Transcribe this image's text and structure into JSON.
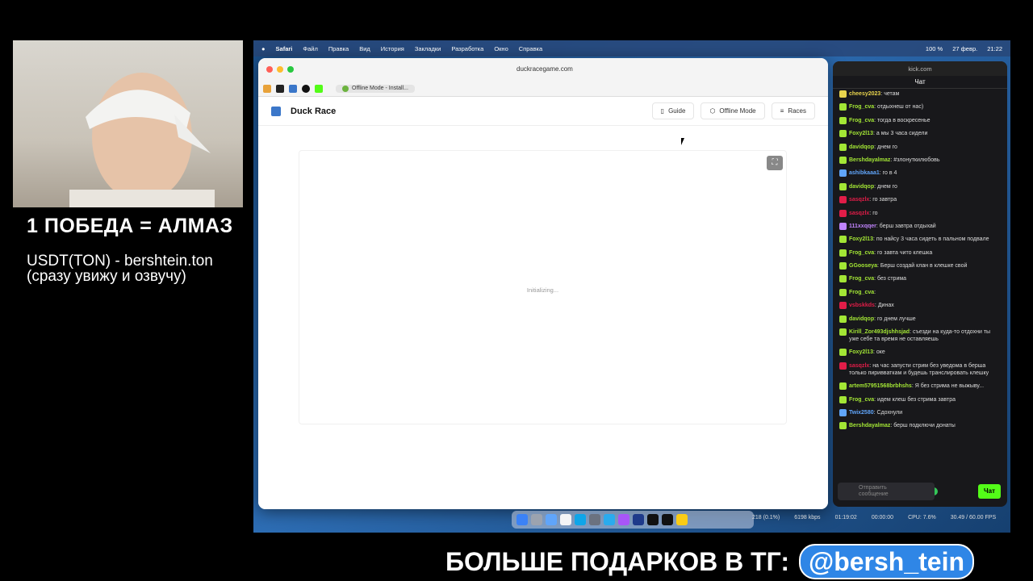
{
  "overlay": {
    "title": "1 ПОБЕДА = АЛМАЗ",
    "wallet_line1": "USDT(TON) - bershtein.ton",
    "wallet_line2": "(сразу увижу и озвучу)",
    "banner": "БОЛЬШЕ ПОДАРКОВ В ТГ:",
    "handle": "@bersh_tein"
  },
  "menubar": {
    "apple": "",
    "items": [
      "Safari",
      "Файл",
      "Правка",
      "Вид",
      "История",
      "Закладки",
      "Разработка",
      "Окно",
      "Справка"
    ],
    "right": [
      "100 %",
      "27 февр.",
      "21:22"
    ]
  },
  "safari": {
    "url": "duckracegame.com",
    "active_tab": "Offline Mode - Install..."
  },
  "site": {
    "title": "Duck Race",
    "nav": [
      "Guide",
      "Offline Mode",
      "Races"
    ],
    "status": "Initializing..."
  },
  "kick": {
    "url": "kick.com",
    "header": "Чат",
    "messages": [
      {
        "user": "cheesy2023",
        "text": "четам",
        "color": "#e8d44d"
      },
      {
        "user": "Frog_cva",
        "text": "отдыхнеш от нас)",
        "color": "#a3e635"
      },
      {
        "user": "Frog_cva",
        "text": "тогда в воскресенье",
        "color": "#a3e635"
      },
      {
        "user": "Foxy2l13",
        "text": "а мы 3 часа сидели",
        "color": "#a3e635"
      },
      {
        "user": "davidqop",
        "text": "днем го",
        "color": "#a3e635"
      },
      {
        "user": "Bershdayalmaz",
        "text": "#злонуткилюбовь",
        "color": "#a3e635"
      },
      {
        "user": "ashibkaaa1",
        "text": "го в 4",
        "color": "#60a5fa"
      },
      {
        "user": "davidqop",
        "text": "днем го",
        "color": "#a3e635"
      },
      {
        "user": "sasqzlx",
        "text": "го завтра",
        "color": "#e11d48"
      },
      {
        "user": "sasqzlx",
        "text": "го",
        "color": "#e11d48"
      },
      {
        "user": "111xxqqer",
        "text": "берш завтра отдыхай",
        "color": "#c084fc"
      },
      {
        "user": "Foxy2l13",
        "text": "по найсу 3 часа сидеть в пальном подвале",
        "color": "#a3e635"
      },
      {
        "user": "Frog_cva",
        "text": "го завта чито клешка",
        "color": "#a3e635"
      },
      {
        "user": "GGooseya",
        "text": "Берш создай клан в клешке свой",
        "color": "#a3e635"
      },
      {
        "user": "Frog_cva",
        "text": "без стрима",
        "color": "#a3e635"
      },
      {
        "user": "Frog_cva",
        "text": "",
        "color": "#a3e635"
      },
      {
        "user": "vsbskkds",
        "text": "Динах",
        "color": "#e11d48"
      },
      {
        "user": "davidqop",
        "text": "го днем лучше",
        "color": "#a3e635"
      },
      {
        "user": "Kirill_Zor493djshhsjad",
        "text": "съезди на куда-то отдохни ты уже себе та время не оставляешь",
        "color": "#a3e635"
      },
      {
        "user": "Foxy2l13",
        "text": "оке",
        "color": "#a3e635"
      },
      {
        "user": "sasqzlx",
        "text": "на час запусти стрим без уведома в берша только пиривваткам и будешь транслировать клешку",
        "color": "#e11d48"
      },
      {
        "user": "artem57951568brbhshs",
        "text": "Я без стрима не выжыву...",
        "color": "#a3e635"
      },
      {
        "user": "Frog_cva",
        "text": "идем клеш без стрима завтра",
        "color": "#a3e635"
      },
      {
        "user": "Twix2580",
        "text": "Сдохнули",
        "color": "#60a5fa"
      },
      {
        "user": "Bershdayalmaz",
        "text": "берш подключи донаты",
        "color": "#a3e635"
      }
    ],
    "input_placeholder": "Отправить сообщение",
    "send": "Чат"
  },
  "obs": {
    "stats": [
      "218 (0.1%)",
      "6198 kbps",
      "01:19:02",
      "00:00:00",
      "CPU: 7.6%",
      "30.49 / 60.00 FPS"
    ]
  }
}
